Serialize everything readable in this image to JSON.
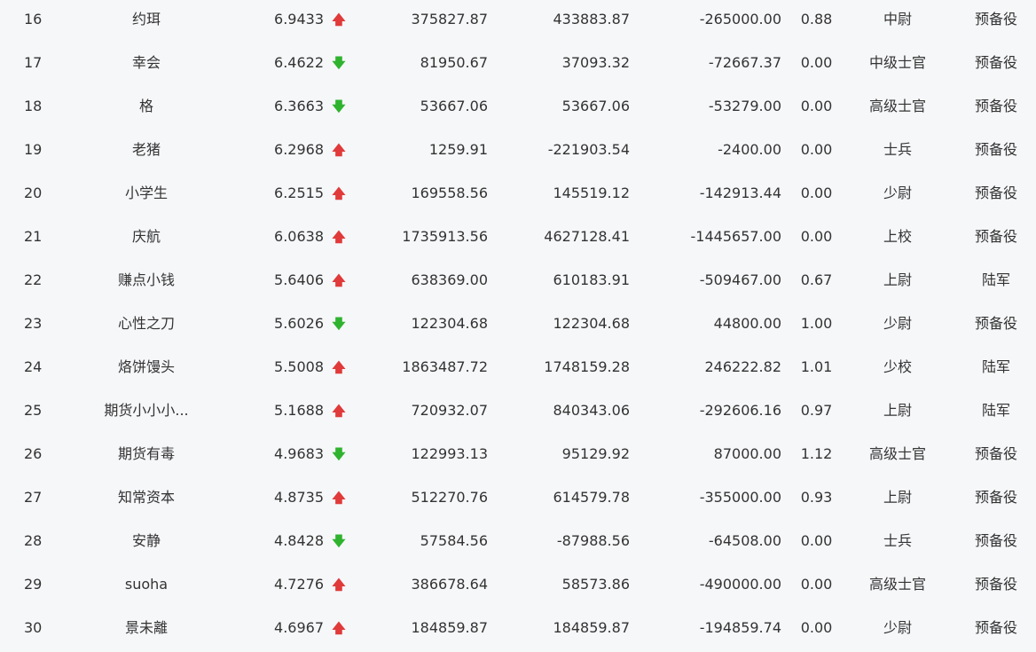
{
  "colors": {
    "up": "#e03a3a",
    "down": "#2fb32f",
    "text": "#333333",
    "background": "#f6f7f9"
  },
  "rows": [
    {
      "rank": "16",
      "name": "约珥",
      "score": "6.9433",
      "trend": "up",
      "arrow": "🡅",
      "v1": "375827.87",
      "v2": "433883.87",
      "v3": "-265000.00",
      "ratio": "0.88",
      "title": "中尉",
      "unit": "预备役"
    },
    {
      "rank": "17",
      "name": "幸会",
      "score": "6.4622",
      "trend": "down",
      "arrow": "🡇",
      "v1": "81950.67",
      "v2": "37093.32",
      "v3": "-72667.37",
      "ratio": "0.00",
      "title": "中级士官",
      "unit": "预备役"
    },
    {
      "rank": "18",
      "name": "格",
      "score": "6.3663",
      "trend": "down",
      "arrow": "🡇",
      "v1": "53667.06",
      "v2": "53667.06",
      "v3": "-53279.00",
      "ratio": "0.00",
      "title": "高级士官",
      "unit": "预备役"
    },
    {
      "rank": "19",
      "name": "老猪",
      "score": "6.2968",
      "trend": "up",
      "arrow": "🡅",
      "v1": "1259.91",
      "v2": "-221903.54",
      "v3": "-2400.00",
      "ratio": "0.00",
      "title": "士兵",
      "unit": "预备役"
    },
    {
      "rank": "20",
      "name": "小学生",
      "score": "6.2515",
      "trend": "up",
      "arrow": "🡅",
      "v1": "169558.56",
      "v2": "145519.12",
      "v3": "-142913.44",
      "ratio": "0.00",
      "title": "少尉",
      "unit": "预备役"
    },
    {
      "rank": "21",
      "name": "庆航",
      "score": "6.0638",
      "trend": "up",
      "arrow": "🡅",
      "v1": "1735913.56",
      "v2": "4627128.41",
      "v3": "-1445657.00",
      "ratio": "0.00",
      "title": "上校",
      "unit": "预备役"
    },
    {
      "rank": "22",
      "name": "赚点小钱",
      "score": "5.6406",
      "trend": "up",
      "arrow": "🡅",
      "v1": "638369.00",
      "v2": "610183.91",
      "v3": "-509467.00",
      "ratio": "0.67",
      "title": "上尉",
      "unit": "陆军"
    },
    {
      "rank": "23",
      "name": "心性之刀",
      "score": "5.6026",
      "trend": "down",
      "arrow": "🡇",
      "v1": "122304.68",
      "v2": "122304.68",
      "v3": "44800.00",
      "ratio": "1.00",
      "title": "少尉",
      "unit": "预备役"
    },
    {
      "rank": "24",
      "name": "烙饼馒头",
      "score": "5.5008",
      "trend": "up",
      "arrow": "🡅",
      "v1": "1863487.72",
      "v2": "1748159.28",
      "v3": "246222.82",
      "ratio": "1.01",
      "title": "少校",
      "unit": "陆军"
    },
    {
      "rank": "25",
      "name": "期货小小小...",
      "score": "5.1688",
      "trend": "up",
      "arrow": "🡅",
      "v1": "720932.07",
      "v2": "840343.06",
      "v3": "-292606.16",
      "ratio": "0.97",
      "title": "上尉",
      "unit": "陆军"
    },
    {
      "rank": "26",
      "name": "期货有毒",
      "score": "4.9683",
      "trend": "down",
      "arrow": "🡇",
      "v1": "122993.13",
      "v2": "95129.92",
      "v3": "87000.00",
      "ratio": "1.12",
      "title": "高级士官",
      "unit": "预备役"
    },
    {
      "rank": "27",
      "name": "知常资本",
      "score": "4.8735",
      "trend": "up",
      "arrow": "🡅",
      "v1": "512270.76",
      "v2": "614579.78",
      "v3": "-355000.00",
      "ratio": "0.93",
      "title": "上尉",
      "unit": "预备役"
    },
    {
      "rank": "28",
      "name": "安静",
      "score": "4.8428",
      "trend": "down",
      "arrow": "🡇",
      "v1": "57584.56",
      "v2": "-87988.56",
      "v3": "-64508.00",
      "ratio": "0.00",
      "title": "士兵",
      "unit": "预备役"
    },
    {
      "rank": "29",
      "name": "suoha",
      "score": "4.7276",
      "trend": "up",
      "arrow": "🡅",
      "v1": "386678.64",
      "v2": "58573.86",
      "v3": "-490000.00",
      "ratio": "0.00",
      "title": "高级士官",
      "unit": "预备役"
    },
    {
      "rank": "30",
      "name": "景未離",
      "score": "4.6967",
      "trend": "up",
      "arrow": "🡅",
      "v1": "184859.87",
      "v2": "184859.87",
      "v3": "-194859.74",
      "ratio": "0.00",
      "title": "少尉",
      "unit": "预备役"
    }
  ]
}
